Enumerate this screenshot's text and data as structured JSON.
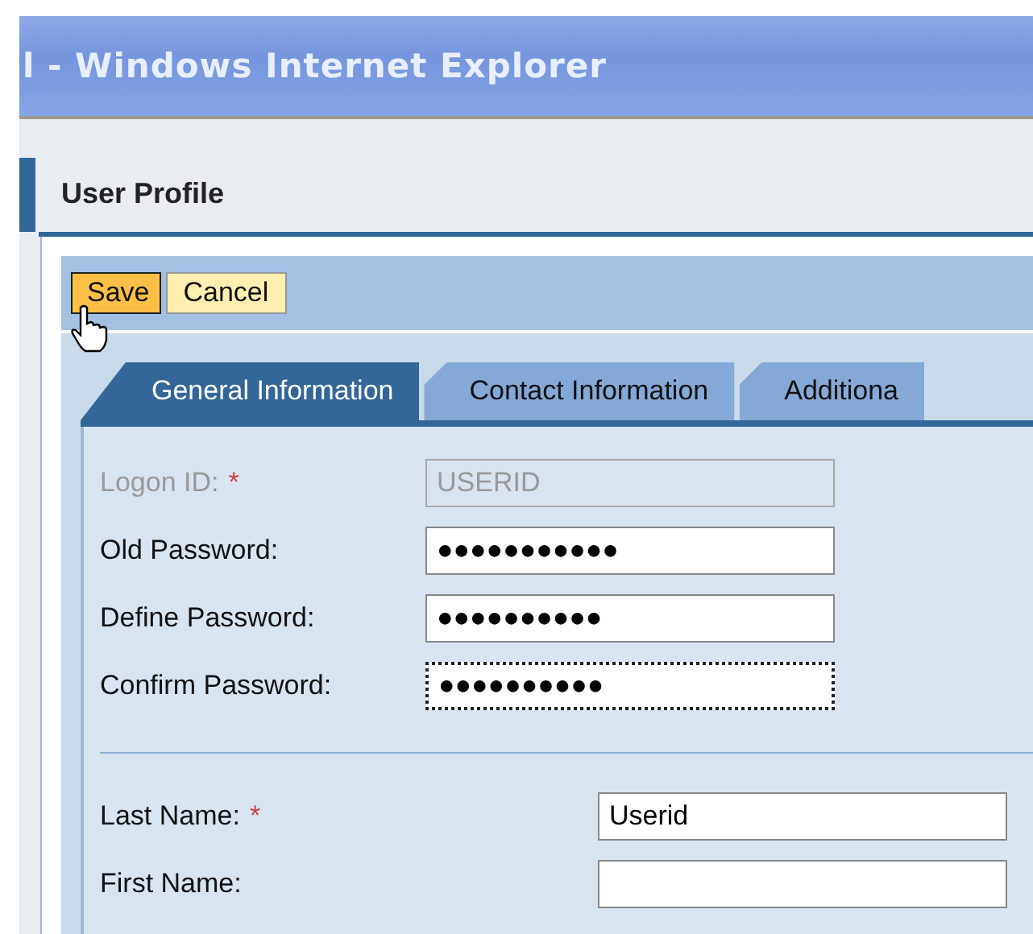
{
  "window": {
    "title": "l - Windows Internet Explorer"
  },
  "page": {
    "title": "User Profile"
  },
  "toolbar": {
    "buttons": [
      {
        "label": "Save",
        "hovered": true
      },
      {
        "label": "Cancel",
        "hovered": false
      }
    ]
  },
  "tabs": [
    {
      "label": "General Information",
      "selected": true
    },
    {
      "label": "Contact Information",
      "selected": false
    },
    {
      "label": "Additiona",
      "selected": false
    }
  ],
  "sections": [
    {
      "fields": [
        {
          "label": "Logon ID:",
          "marker": "*",
          "value": "USERID",
          "disabled": true,
          "focused": false
        },
        {
          "label": "Old Password:",
          "value": "●●●●●●●●●●●",
          "disabled": false,
          "focused": false
        },
        {
          "label": "Define Password:",
          "value": "●●●●●●●●●●",
          "disabled": false,
          "focused": false
        },
        {
          "label": "Confirm Password:",
          "value": "●●●●●●●●●●",
          "disabled": false,
          "focused": true
        }
      ]
    },
    {
      "fields": [
        {
          "label": "Last Name:",
          "marker": "*",
          "value": "Userid",
          "disabled": false,
          "focused": false
        },
        {
          "label": "First Name:",
          "disabled": false,
          "focused": false
        }
      ]
    }
  ]
}
